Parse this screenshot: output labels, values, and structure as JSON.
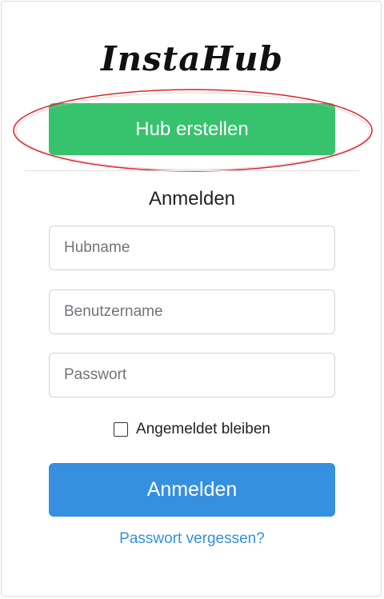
{
  "brand": {
    "logo_text": "InstaHub"
  },
  "actions": {
    "create_hub_label": "Hub erstellen"
  },
  "login_form": {
    "title": "Anmelden",
    "hubname_placeholder": "Hubname",
    "username_placeholder": "Benutzername",
    "password_placeholder": "Passwort",
    "remember_label": "Angemeldet bleiben",
    "remember_checked": false,
    "submit_label": "Anmelden",
    "forgot_password_label": "Passwort vergessen?"
  },
  "colors": {
    "create_button": "#37c36d",
    "login_button": "#3590e0",
    "link": "#3590e0",
    "highlight_ellipse": "#d9252a"
  }
}
